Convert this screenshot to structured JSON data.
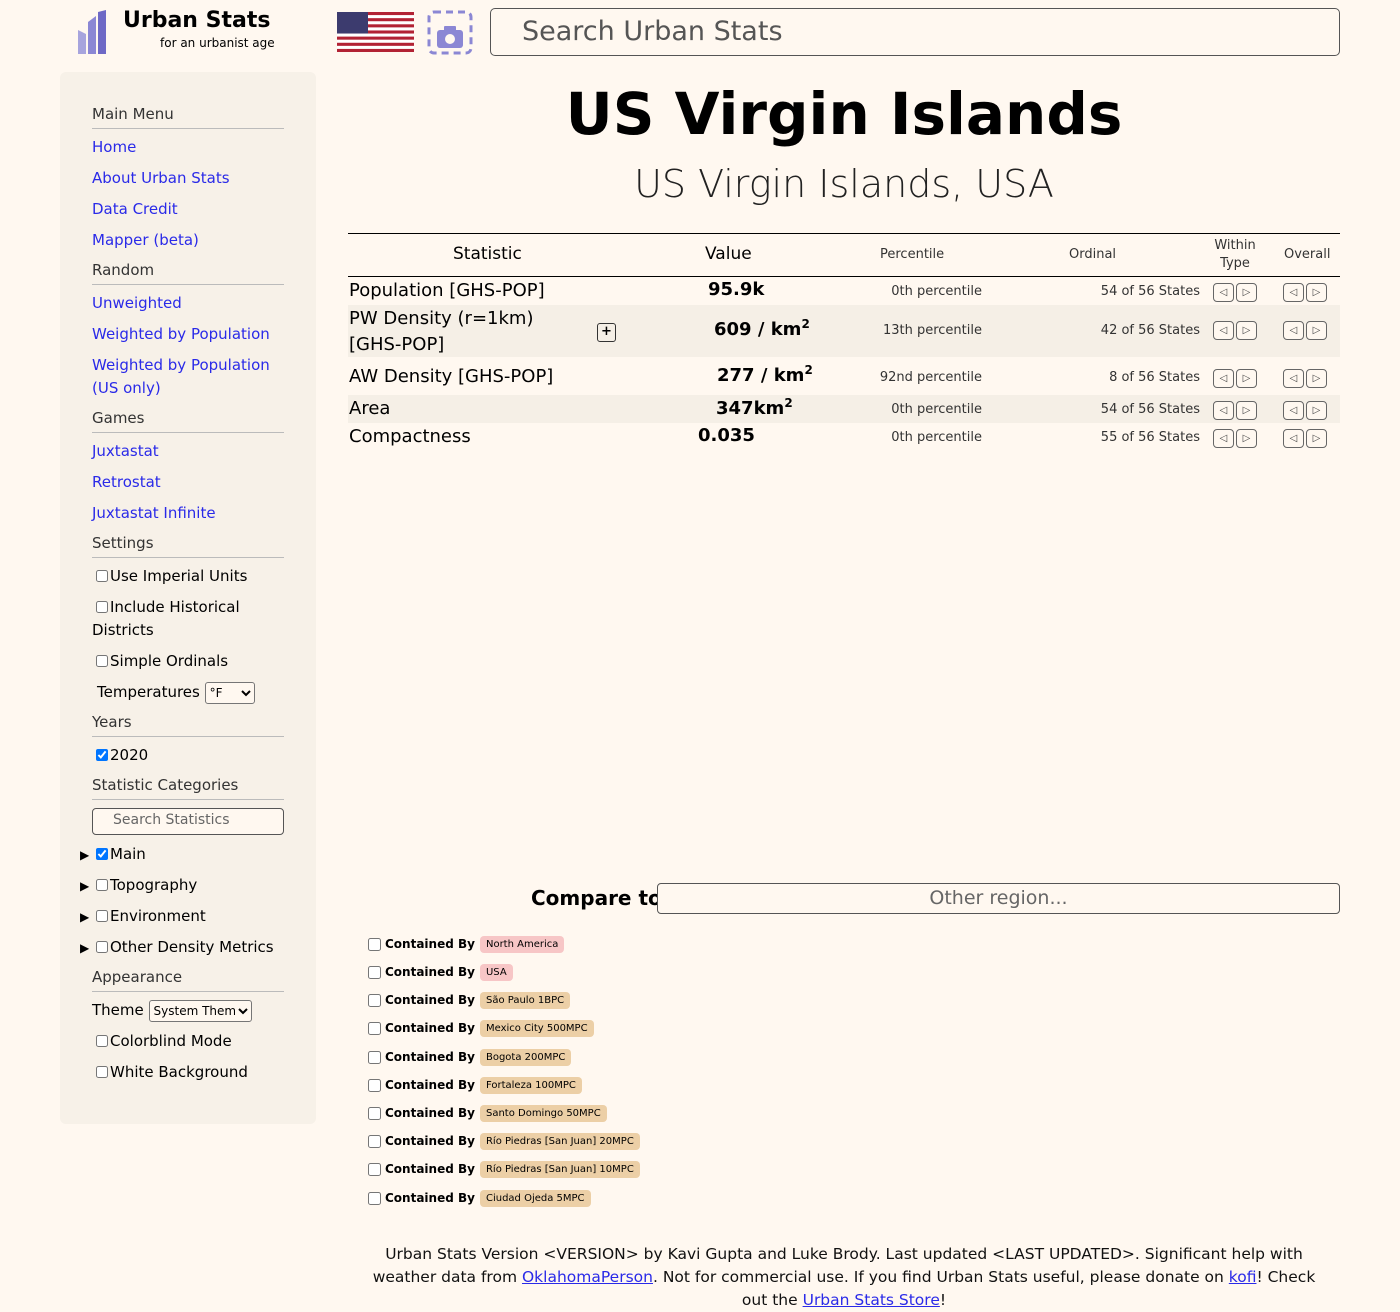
{
  "header": {
    "logo_title": "Urban Stats",
    "logo_tagline": "for an urbanist age",
    "search_placeholder": "Search Urban Stats"
  },
  "sidebar": {
    "sections": {
      "main_menu": "Main Menu",
      "random": "Random",
      "games": "Games",
      "settings": "Settings",
      "years": "Years",
      "statistic_categories": "Statistic Categories",
      "appearance": "Appearance"
    },
    "main_menu_links": [
      "Home",
      "About Urban Stats",
      "Data Credit",
      "Mapper (beta)"
    ],
    "random_links": [
      "Unweighted",
      "Weighted by Population",
      "Weighted by Population (US only)"
    ],
    "game_links": [
      "Juxtastat",
      "Retrostat",
      "Juxtastat Infinite"
    ],
    "settings": {
      "imperial": "Use Imperial Units",
      "historical": "Include Historical Districts",
      "simple_ordinals": "Simple Ordinals",
      "temperatures_label": "Temperatures",
      "temperature_unit": "°F"
    },
    "years": {
      "label_2020": "2020"
    },
    "stat_search_placeholder": "Search Statistics",
    "categories": [
      "Main",
      "Topography",
      "Environment",
      "Other Density Metrics"
    ],
    "appearance": {
      "theme_label": "Theme",
      "theme_value": "System Theme",
      "colorblind": "Colorblind Mode",
      "white_bg": "White Background"
    }
  },
  "page": {
    "title": "US Virgin Islands",
    "subtitle": "US Virgin Islands, USA"
  },
  "table": {
    "headers": {
      "statistic": "Statistic",
      "value": "Value",
      "percentile": "Percentile",
      "ordinal": "Ordinal",
      "within_type_1": "Within",
      "within_type_2": "Type",
      "overall": "Overall"
    },
    "rows": [
      {
        "stat": "Population [GHS-POP]",
        "value": "95.9",
        "unit": "k",
        "percentile": "0th percentile",
        "ordinal": "54 of 56 States"
      },
      {
        "stat": "PW Density (r=1km) [GHS-POP]",
        "value": "609",
        "unit": "/ km",
        "percentile": "13th percentile",
        "ordinal": "42 of 56 States"
      },
      {
        "stat": "AW Density [GHS-POP]",
        "value": "277",
        "unit": "/ km",
        "percentile": "92nd percentile",
        "ordinal": "8 of 56 States"
      },
      {
        "stat": "Area",
        "value": "347",
        "unit": "km",
        "percentile": "0th percentile",
        "ordinal": "54 of 56 States"
      },
      {
        "stat": "Compactness",
        "value": "0.035",
        "unit": "",
        "percentile": "0th percentile",
        "ordinal": "55 of 56 States"
      }
    ],
    "prev_arrow": "◁",
    "next_arrow": "▷",
    "expand_symbol": "+",
    "superscript": "2"
  },
  "compare": {
    "label": "Compare to:",
    "placeholder": "Other region...",
    "contained_by_label": "Contained By",
    "regions": [
      "North America",
      "USA",
      "São Paulo 1BPC",
      "Mexico City 500MPC",
      "Bogota 200MPC",
      "Fortaleza 100MPC",
      "Santo Domingo 50MPC",
      "Río Piedras [San Juan] 20MPC",
      "Río Piedras [San Juan] 10MPC",
      "Ciudad Ojeda 5MPC"
    ]
  },
  "footer": {
    "part1": "Urban Stats Version <VERSION> by Kavi Gupta and Luke Brody. Last updated <LAST UPDATED>. Significant help with weather data from ",
    "link1": "OklahomaPerson",
    "part2": ". Not for commercial use. If you find Urban Stats useful, please donate on ",
    "link2": "kofi",
    "part3": "! Check out the ",
    "link3": "Urban Stats Store",
    "part4": "!"
  },
  "colors": {
    "background": "#fff8f0",
    "sidebar": "#f7f1e8",
    "link": "#2a2ae8",
    "pill_pink": "#f7c6c6",
    "pill_tan": "#eccfa6",
    "logo_purple": "#8b87d4"
  }
}
